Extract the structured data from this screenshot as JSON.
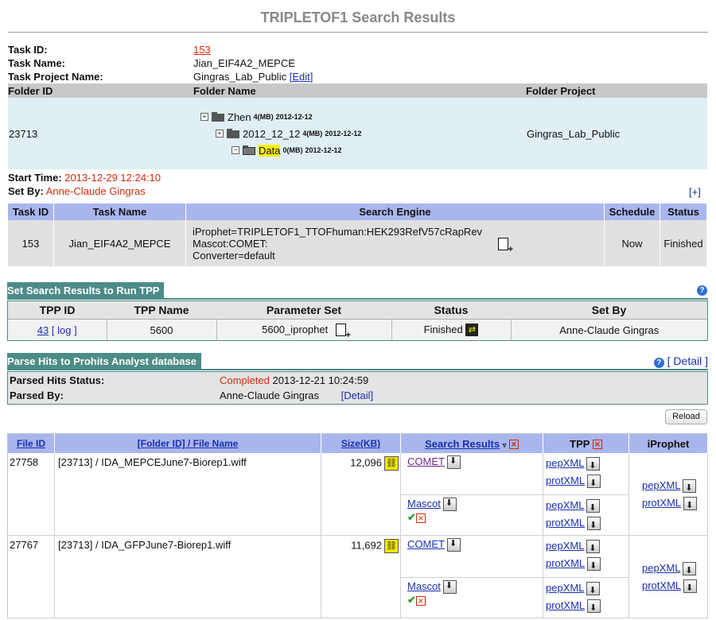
{
  "page": {
    "title": "TRIPLETOF1 Search Results"
  },
  "task": {
    "id_label": "Task ID:",
    "id": "153",
    "name_label": "Task Name:",
    "name": "Jian_EIF4A2_MEPCE",
    "project_label": "Task Project Name:",
    "project": "Gingras_Lab_Public",
    "edit": "[Edit]"
  },
  "folder": {
    "headers": [
      "Folder ID",
      "Folder Name",
      "Folder Project"
    ],
    "id": "23713",
    "tree": [
      {
        "name": "Zhen",
        "size": "4(MB)",
        "date": "2012-12-12"
      },
      {
        "name": "2012_12_12",
        "size": "4(MB)",
        "date": "2012-12-12"
      },
      {
        "name": "Data",
        "size": "0(MB)",
        "date": "2012-12-12"
      }
    ],
    "project": "Gingras_Lab_Public"
  },
  "start": {
    "label": "Start Time:",
    "value": "2013-12-29 12:24:10",
    "setby_label": "Set By:",
    "setby": "Anne-Claude Gingras",
    "expand": "[+]"
  },
  "task_table": {
    "headers": [
      "Task ID",
      "Task Name",
      "Search Engine",
      "Schedule",
      "Status"
    ],
    "row": {
      "id": "153",
      "name": "Jian_EIF4A2_MEPCE",
      "engine_1": "iProphet=TRIPLETOF1_TTOFhuman:HEK293RefV57cRapRev",
      "engine_2": "Mascot:COMET:",
      "engine_3": "Converter=default",
      "schedule": "Now",
      "status": "Finished"
    }
  },
  "tpp_section": {
    "title": "Set Search Results to Run TPP",
    "headers": [
      "TPP ID",
      "TPP Name",
      "Parameter Set",
      "Status",
      "Set By"
    ],
    "row": {
      "id": "43",
      "log": "[ log ]",
      "name": "5600",
      "param": "5600_iprophet",
      "status": "Finished",
      "setby": "Anne-Claude Gingras"
    }
  },
  "parse_section": {
    "title": "Parse Hits to Prohits Analyst database",
    "detail": "[ Detail ]",
    "status_label": "Parsed Hits Status:",
    "status": "Completed",
    "status_time": "2013-12-21 10:24:59",
    "by_label": "Parsed By:",
    "by": "Anne-Claude Gingras",
    "by_detail": "[Detail]"
  },
  "reload": "Reload",
  "results": {
    "headers": {
      "file_id": "File ID",
      "file_name": "[Folder ID] / File Name",
      "size": "Size(KB)",
      "search": "Search Results",
      "tpp": "TPP",
      "iprophet": "iProphet"
    },
    "rows": [
      {
        "id": "27758",
        "name": "[23713] / IDA_MEPCEJune7-Biorep1.wiff",
        "size": "12,096",
        "engines": [
          "COMET",
          "Mascot"
        ],
        "pep": "pepXML",
        "prot": "protXML"
      },
      {
        "id": "27767",
        "name": "[23713] / IDA_GFPJune7-Biorep1.wiff",
        "size": "11,692",
        "engines": [
          "COMET",
          "Mascot"
        ],
        "pep": "pepXML",
        "prot": "protXML"
      }
    ]
  }
}
